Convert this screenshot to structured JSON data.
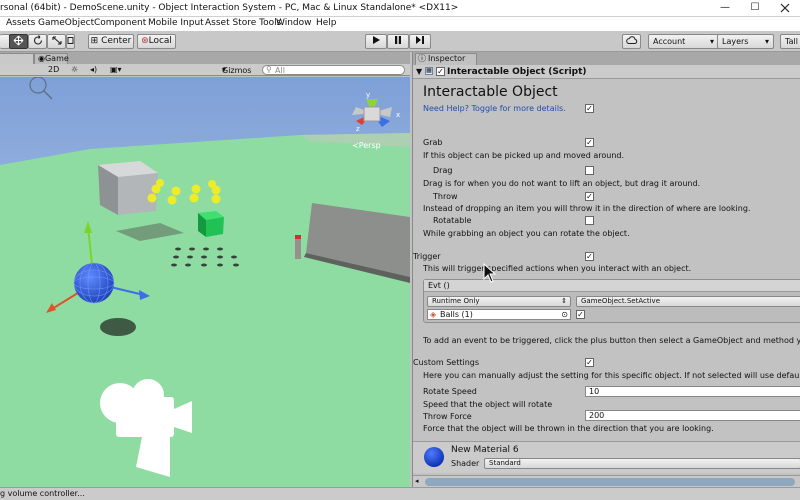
{
  "window": {
    "title": "rsonal (64bit) - DemoScene.unity - Object Interaction System - PC, Mac & Linux Standalone* <DX11>",
    "minimize": "—",
    "maximize": "☐"
  },
  "menu": [
    "Assets",
    "GameObject",
    "Component",
    "Mobile Input",
    "Asset Store Tools",
    "Window",
    "Help"
  ],
  "toolbar": {
    "pivot": "Center",
    "space": "Local",
    "account": "Account",
    "layers": "Layers",
    "layout": "Tall"
  },
  "scene": {
    "game_tab": "Game",
    "mode_2d": "2D",
    "gizmos": "Gizmos",
    "search_all": "All",
    "persp": "Persp"
  },
  "inspector": {
    "tab": "Inspector",
    "component_title": "Interactable Object (Script)",
    "heading": "Interactable Object",
    "help_text": "Need Help? Toggle for more details.",
    "help_checked": true,
    "grab_label": "Grab",
    "grab_checked": true,
    "grab_desc": "If this object can be picked up and moved around.",
    "drag_label": "Drag",
    "drag_checked": false,
    "drag_desc": "Drag is for when you do not want to lift an object, but drag it around.",
    "throw_label": "Throw",
    "throw_checked": true,
    "throw_desc": "Instead of dropping an item you will throw it in the direction of where are looking.",
    "rotatable_label": "Rotatable",
    "rotatable_checked": false,
    "rotatable_desc": "While grabbing an object you can rotate the object.",
    "trigger_label": "Trigger",
    "trigger_checked": true,
    "trigger_desc": "This will trigger specified actions when you interact with an object.",
    "evt_label": "Evt ()",
    "runtime_option": "Runtime Only",
    "function_option": "GameObject.SetActive",
    "target_object": "Balls (1)",
    "target_checked": true,
    "add_event_desc": "To add an event to be triggered, click the plus button then select a GameObject and method yo",
    "custom_settings_label": "Custom Settings",
    "custom_settings_checked": true,
    "custom_settings_desc": "Here you can manually adjust the setting for this specific object. If not selected will use default",
    "rotate_speed_label": "Rotate Speed",
    "rotate_speed_value": "10",
    "rotate_speed_desc": "Speed that the object will rotate",
    "throw_force_label": "Throw Force",
    "throw_force_value": "200",
    "throw_force_desc": "Force that the object will be thrown in the direction that you are looking.",
    "material_name": "New Material 6",
    "shader_label": "Shader",
    "shader_value": "Standard"
  },
  "status": {
    "text": "g volume controller..."
  },
  "colors": {
    "floor": "#8fdca2",
    "sky": "#90b0e0",
    "accent_blue": "#2a5bd7",
    "checkbox_check": "#1f4fa8",
    "inspector_bg": "#c2c2c2"
  }
}
